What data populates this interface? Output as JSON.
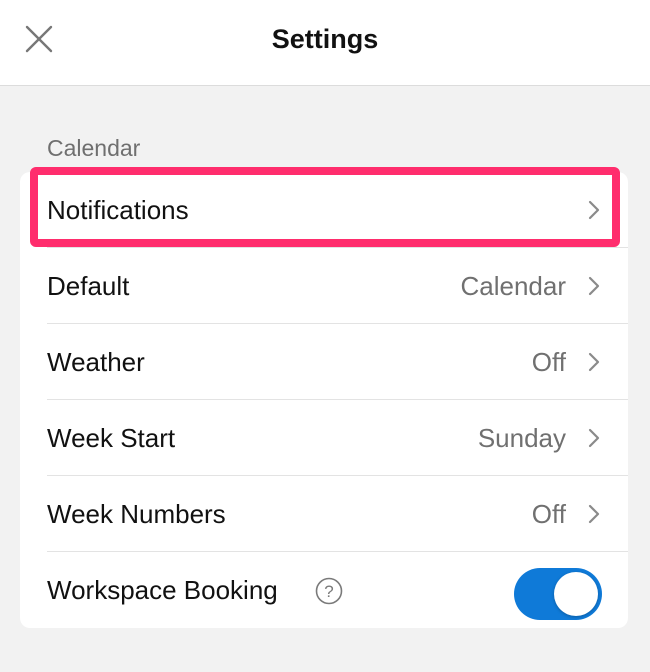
{
  "header": {
    "title": "Settings",
    "close_icon": "close-icon"
  },
  "section": {
    "title": "Calendar"
  },
  "rows": [
    {
      "label": "Notifications",
      "value": ""
    },
    {
      "label": "Default",
      "value": "Calendar"
    },
    {
      "label": "Weather",
      "value": "Off"
    },
    {
      "label": "Week Start",
      "value": "Sunday"
    },
    {
      "label": "Week Numbers",
      "value": "Off"
    },
    {
      "label": "Workspace Booking",
      "toggle_on": true
    }
  ],
  "colors": {
    "highlight": "#ff2d6d",
    "toggle_on": "#0f7ad8",
    "background": "#f2f2f2"
  }
}
